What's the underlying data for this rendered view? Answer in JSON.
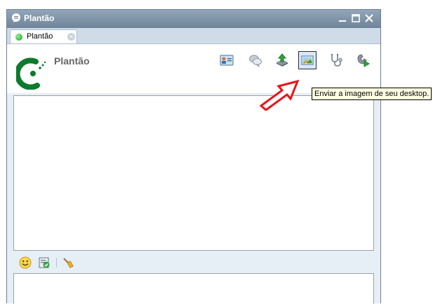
{
  "window": {
    "title": "Plantão",
    "icon": "chat-bubble-icon",
    "controls": [
      "minimize-icon",
      "maximize-icon",
      "close-icon"
    ],
    "title_text_color": "#ffffff"
  },
  "tabs": [
    {
      "label": "Plantão",
      "status": "online",
      "status_color": "#1aa51a"
    }
  ],
  "header": {
    "contact_name": "Plantão",
    "logo": "signal-logo-icon"
  },
  "toolbar": [
    {
      "icon": "contact-card-icon"
    },
    {
      "icon": "chat-bubbles-icon"
    },
    {
      "icon": "upload-file-icon"
    },
    {
      "icon": "desktop-image-icon",
      "active": true
    },
    {
      "icon": "stethoscope-icon"
    },
    {
      "icon": "phone-call-icon"
    }
  ],
  "tooltip": {
    "text": "Enviar a imagem de seu desktop."
  },
  "input_toolbar": [
    {
      "icon": "smiley-icon"
    },
    {
      "icon": "checklist-icon"
    },
    {
      "icon": "broom-icon"
    }
  ],
  "annotation": {
    "arrow_color": "#e8141a"
  }
}
